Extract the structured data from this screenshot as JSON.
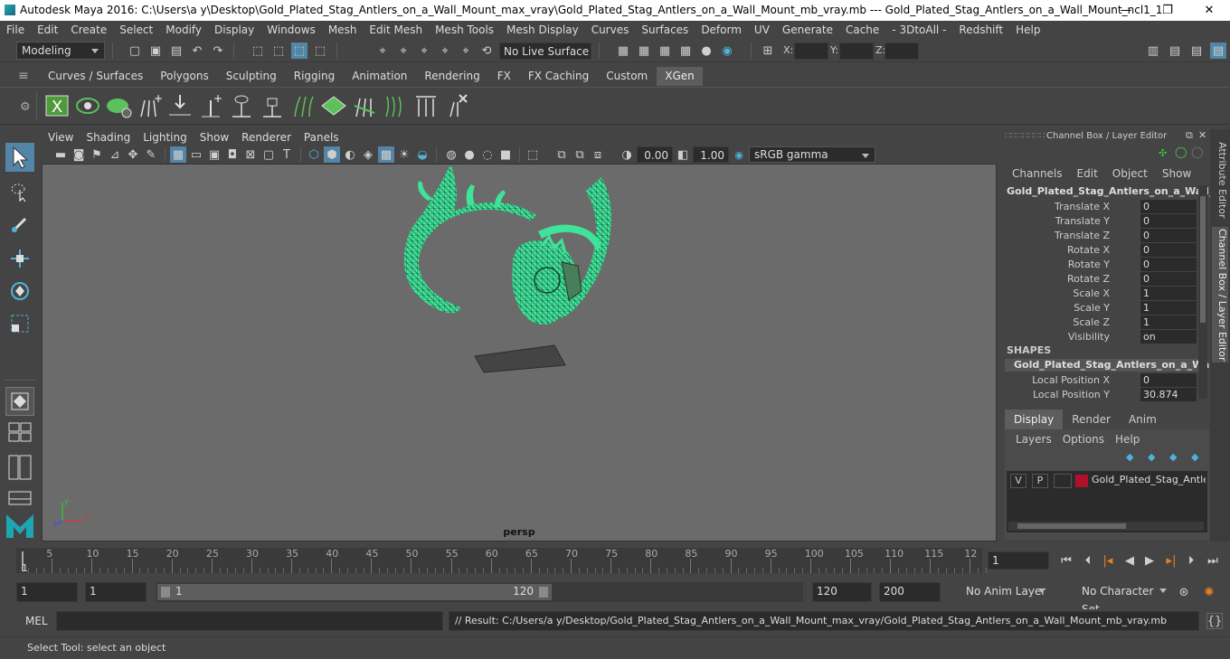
{
  "window": {
    "title": "Autodesk Maya 2016: C:\\Users\\a y\\Desktop\\Gold_Plated_Stag_Antlers_on_a_Wall_Mount_max_vray\\Gold_Plated_Stag_Antlers_on_a_Wall_Mount_mb_vray.mb   ---   Gold_Plated_Stag_Antlers_on_a_Wall_Mount_ncl1_1",
    "controls": [
      "—",
      "❐",
      "✕"
    ]
  },
  "menubar": [
    "File",
    "Edit",
    "Create",
    "Select",
    "Modify",
    "Display",
    "Windows",
    "Mesh",
    "Edit Mesh",
    "Mesh Tools",
    "Mesh Display",
    "Curves",
    "Surfaces",
    "Deform",
    "UV",
    "Generate",
    "Cache",
    "- 3DtoAll -",
    "Redshift",
    "Help"
  ],
  "statusline": {
    "mode": "Modeling",
    "live_surface": "No Live Surface",
    "x_label": "X:",
    "y_label": "Y:",
    "z_label": "Z:"
  },
  "shelf": {
    "tabs": [
      "Curves / Surfaces",
      "Polygons",
      "Sculpting",
      "Rigging",
      "Animation",
      "Rendering",
      "FX",
      "FX Caching",
      "Custom",
      "XGen"
    ],
    "active_tab": "XGen"
  },
  "viewport": {
    "menu": [
      "View",
      "Shading",
      "Lighting",
      "Show",
      "Renderer",
      "Panels"
    ],
    "exposure": "0.00",
    "gamma": "1.00",
    "color_space": "sRGB gamma",
    "camera_label": "persp",
    "axis_labels": [
      "x",
      "y",
      "z"
    ]
  },
  "channel_box": {
    "header": "Channel Box / Layer Editor",
    "menu": [
      "Channels",
      "Edit",
      "Object",
      "Show"
    ],
    "object_name": "Gold_Plated_Stag_Antlers_on_a_Wall_...",
    "channels": [
      {
        "name": "Translate X",
        "value": "0"
      },
      {
        "name": "Translate Y",
        "value": "0"
      },
      {
        "name": "Translate Z",
        "value": "0"
      },
      {
        "name": "Rotate X",
        "value": "0"
      },
      {
        "name": "Rotate Y",
        "value": "0"
      },
      {
        "name": "Rotate Z",
        "value": "0"
      },
      {
        "name": "Scale X",
        "value": "1"
      },
      {
        "name": "Scale Y",
        "value": "1"
      },
      {
        "name": "Scale Z",
        "value": "1"
      },
      {
        "name": "Visibility",
        "value": "on"
      }
    ],
    "shapes_header": "SHAPES",
    "shape_name": "Gold_Plated_Stag_Antlers_on_a_Wal...",
    "shape_channels": [
      {
        "name": "Local Position X",
        "value": "0"
      },
      {
        "name": "Local Position Y",
        "value": "30.874"
      }
    ]
  },
  "layer_editor": {
    "tabs": [
      "Display",
      "Render",
      "Anim"
    ],
    "active_tab": "Display",
    "menu": [
      "Layers",
      "Options",
      "Help"
    ],
    "layers": [
      {
        "visible": "V",
        "playback": "P",
        "name": "Gold_Plated_Stag_Antler",
        "color": "#b0102a"
      }
    ]
  },
  "side_tabs": [
    "Attribute Editor",
    "Channel Box / Layer Editor"
  ],
  "timeline": {
    "ticks": [
      "5",
      "10",
      "15",
      "20",
      "25",
      "30",
      "35",
      "40",
      "45",
      "50",
      "55",
      "60",
      "65",
      "70",
      "75",
      "80",
      "85",
      "90",
      "95",
      "100",
      "105",
      "110",
      "115",
      "12"
    ],
    "current_frame_marker": "1",
    "current_frame": "1"
  },
  "range": {
    "start": "1",
    "playback_start": "1",
    "slider_start": "1",
    "slider_end": "120",
    "playback_end": "120",
    "end": "200",
    "anim_layer": "No Anim Layer",
    "character_set": "No Character Set"
  },
  "mel": {
    "label": "MEL",
    "result": "// Result: C:/Users/a y/Desktop/Gold_Plated_Stag_Antlers_on_a_Wall_Mount_max_vray/Gold_Plated_Stag_Antlers_on_a_Wall_Mount_mb_vray.mb"
  },
  "help_line": "Select Tool: select an object",
  "colors": {
    "wireframe": "#3fe39a",
    "viewport_bg": "#6b6b6b",
    "panel_bg": "#444444",
    "accent": "#5285a6"
  }
}
